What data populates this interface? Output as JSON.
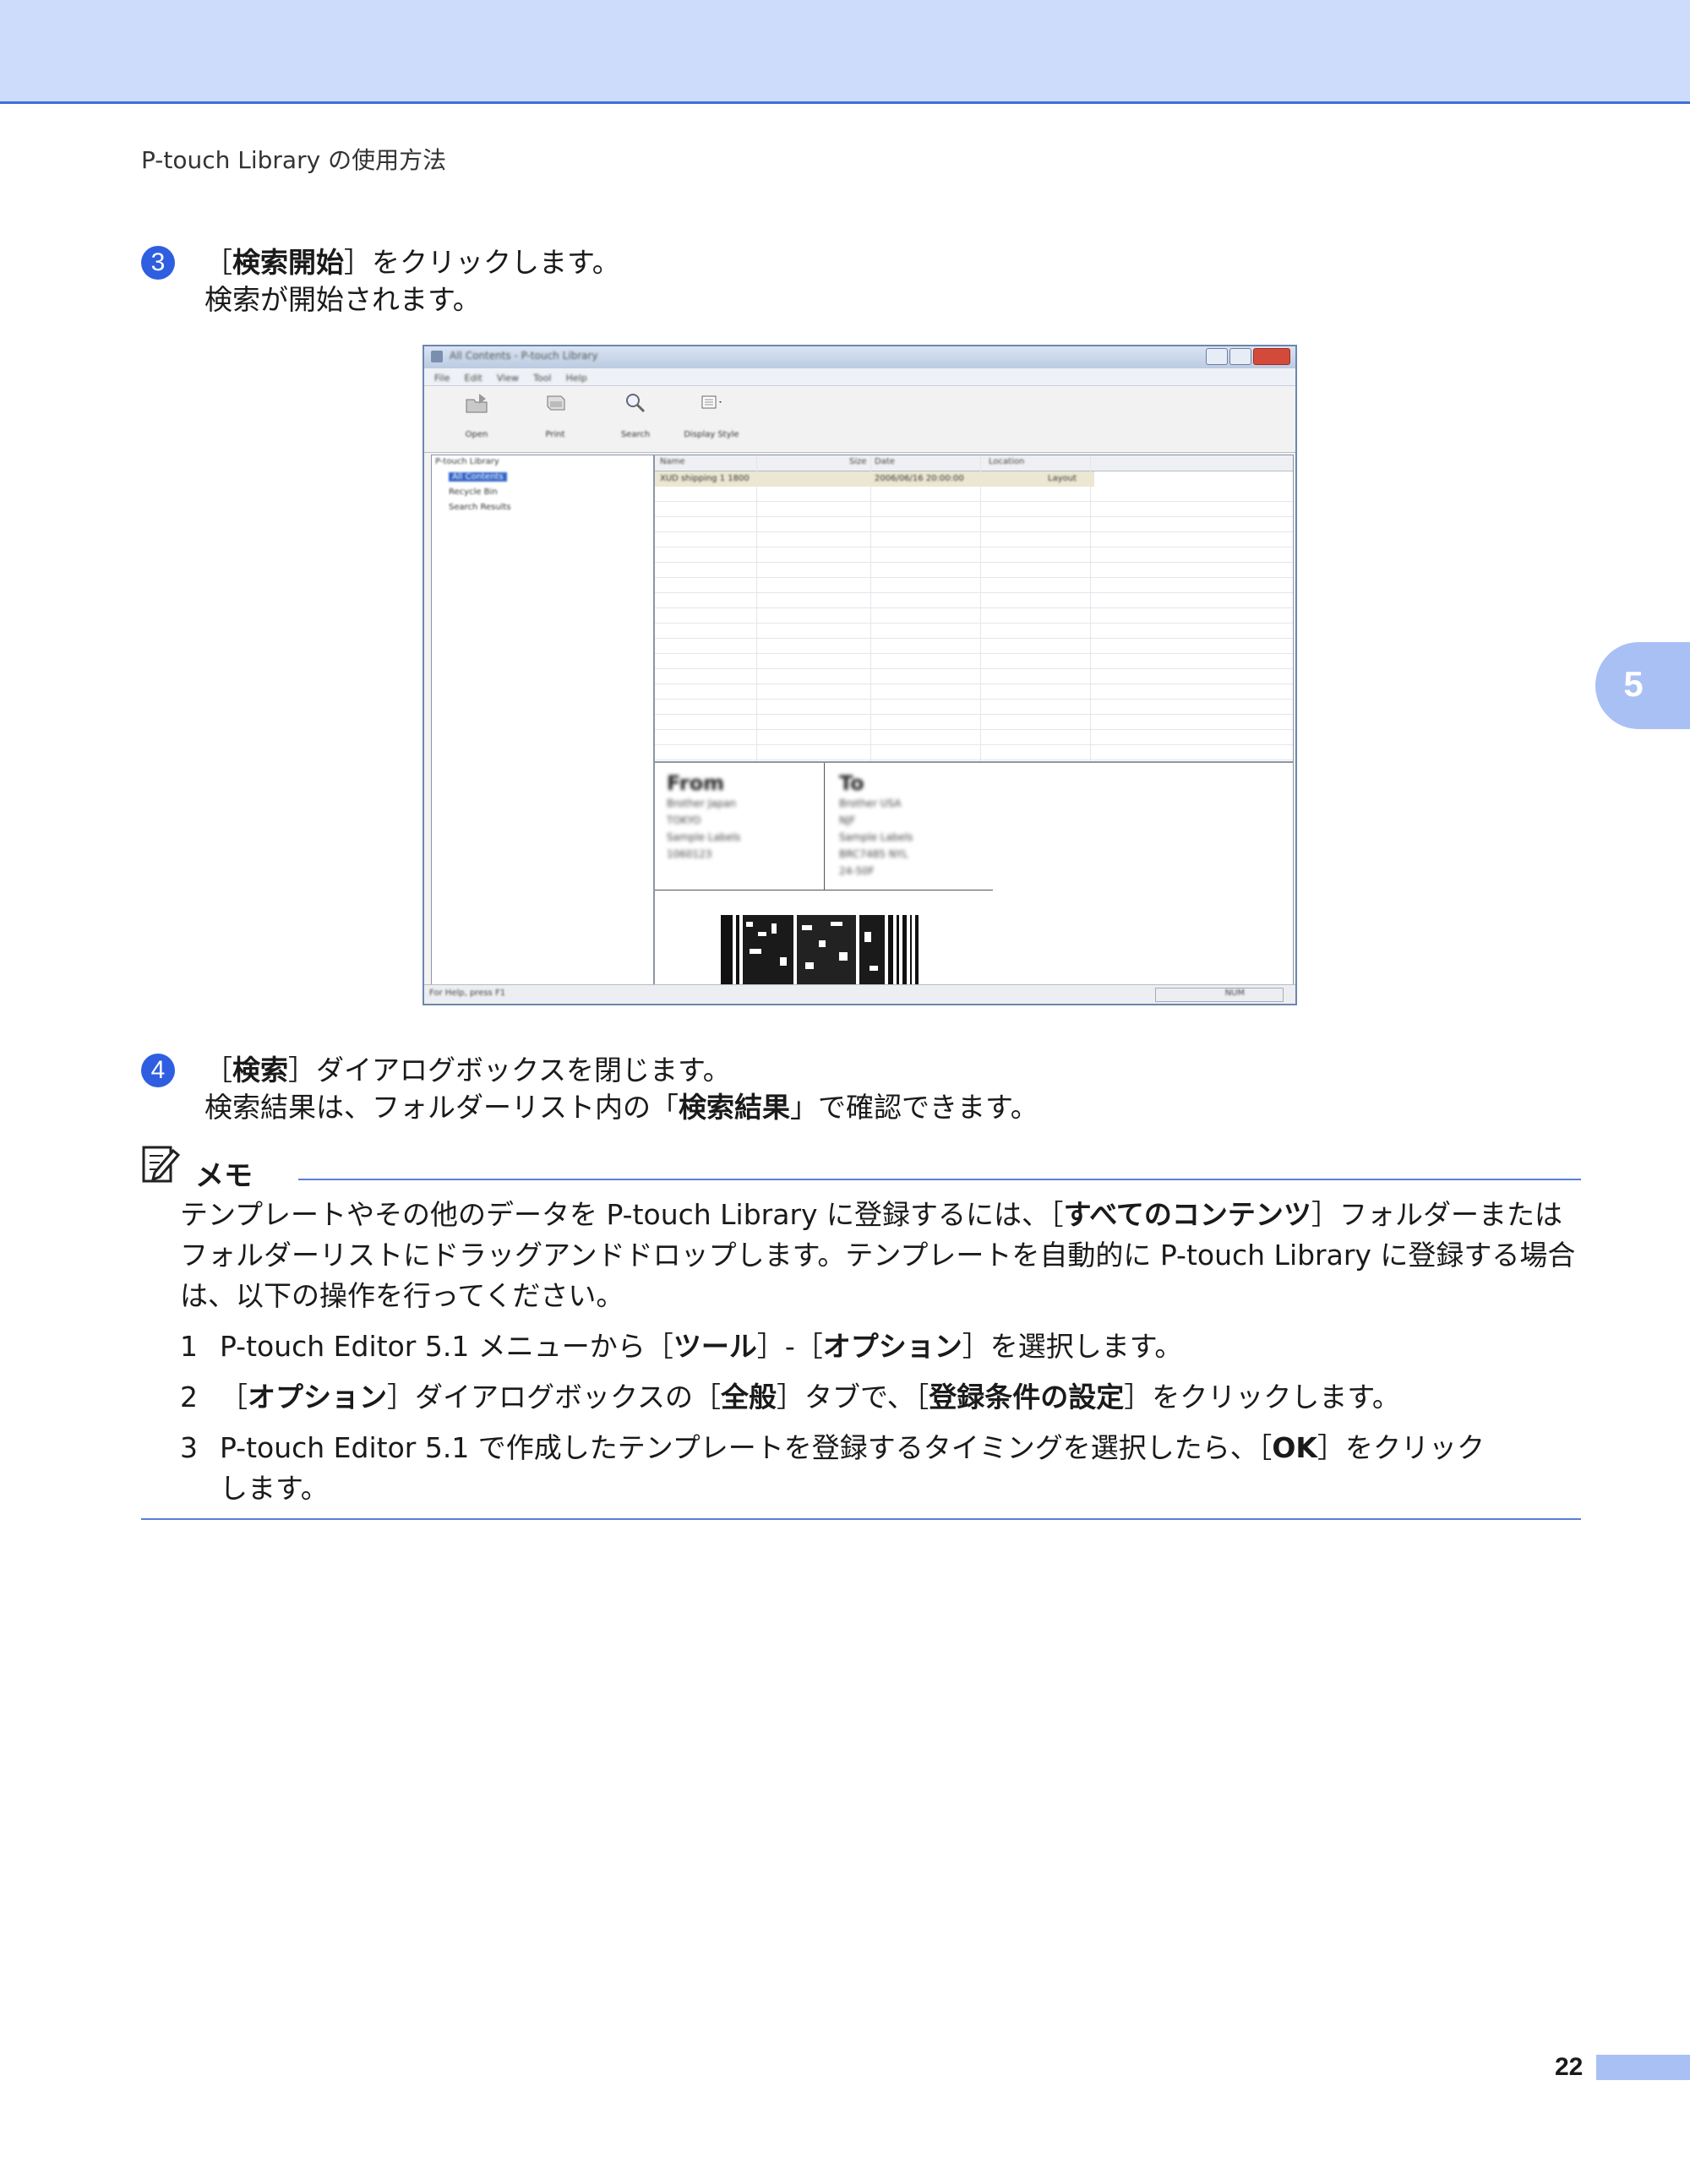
{
  "header": {
    "title": "P-touch Library の使用方法"
  },
  "side_tab": {
    "chapter": "5"
  },
  "steps": [
    {
      "number": "3",
      "line1_pre": "［",
      "line1_bold": "検索開始",
      "line1_post": "］をクリックします。",
      "line2": "検索が開始されます。"
    },
    {
      "number": "4",
      "line1_pre": "［",
      "line1_bold": "検索",
      "line1_post": "］ダイアログボックスを閉じます。",
      "line2_pre": "検索結果は、フォルダーリスト内の「",
      "line2_bold": "検索結果",
      "line2_post": "」で確認できます。"
    }
  ],
  "screenshot": {
    "window_title": "All Contents - P-touch Library",
    "menu": [
      "File",
      "Edit",
      "View",
      "Tool",
      "Help"
    ],
    "toolbar": [
      "Open",
      "Print",
      "Search",
      "Display Style"
    ],
    "tree": [
      "P-touch Library",
      "All Contents",
      "Recycle Bin",
      "Search Results"
    ],
    "columns": [
      "Name",
      "Size",
      "Date",
      "Location"
    ],
    "row": {
      "name": "XUD shipping 1 1800",
      "date": "2006/06/16 20:00:00",
      "location": "Layout"
    },
    "label_preview": {
      "from_heading": "From",
      "from_lines": [
        "Brother Japan",
        "TOKYO",
        "Sample Labels",
        "1060123"
      ],
      "to_heading": "To",
      "to_lines": [
        "Brother USA",
        "NJF",
        "Sample Labels",
        "BRC7485 NYL",
        "24-50F"
      ]
    },
    "status": "For Help, press F1",
    "status_num": "NUM"
  },
  "memo": {
    "title": "メモ",
    "para_pre": "テンプレートやその他のデータを P-touch Library に登録するには、［",
    "para_bold": "すべてのコンテンツ",
    "para_post": "］フォルダーまたはフォルダーリストにドラッグアンドドロップします。テンプレートを自動的に P-touch Library に登録する場合は、以下の操作を行ってください。",
    "items": [
      {
        "n": "1",
        "pre": "P-touch Editor 5.1 メニューから［",
        "b1": "ツール",
        "mid": "］-［",
        "b2": "オプション",
        "post": "］を選択します。"
      },
      {
        "n": "2",
        "pre": "［",
        "b1": "オプション",
        "mid": "］ダイアログボックスの［",
        "b2": "全般",
        "mid2": "］タブで、［",
        "b3": "登録条件の設定",
        "post": "］をクリックします。"
      },
      {
        "n": "3",
        "pre": "P-touch Editor 5.1 で作成したテンプレートを登録するタイミングを選択したら、［",
        "b1": "OK",
        "post": "］をクリック",
        "line2": "します。"
      }
    ]
  },
  "footer": {
    "page": "22"
  }
}
